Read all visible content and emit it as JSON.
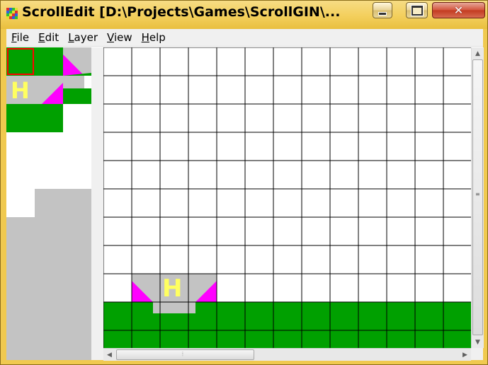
{
  "window": {
    "title": "ScrollEdit [D:\\Projects\\Games\\ScrollGIN\\...",
    "icon_name": "app-icon",
    "minimize_icon": "minimize-icon",
    "maximize_icon": "maximize-icon",
    "close_icon": "close-icon"
  },
  "menu": {
    "items": [
      {
        "label": "File",
        "mnemonic": "F",
        "rest": "ile"
      },
      {
        "label": "Edit",
        "mnemonic": "E",
        "rest": "dit"
      },
      {
        "label": "Layer",
        "mnemonic": "L",
        "rest": "ayer"
      },
      {
        "label": "View",
        "mnemonic": "V",
        "rest": "iew"
      },
      {
        "label": "Help",
        "mnemonic": "H",
        "rest": "elp"
      }
    ]
  },
  "palette": {
    "selected_tile": "green-tile",
    "tiles": [
      "green-tile",
      "green-tile",
      "ramp-left",
      "helipad-h",
      "ramp-right",
      "green-tile",
      "green-tile",
      "green-tile"
    ]
  },
  "map": {
    "helipad_letter": "H",
    "grid_columns": 13,
    "grid_rows": 11
  },
  "colors": {
    "grass": "#00a000",
    "concrete": "#c3c3c3",
    "ramp": "#ff00ff",
    "selection": "#ff0000",
    "helipad_letter": "#ffff60"
  }
}
